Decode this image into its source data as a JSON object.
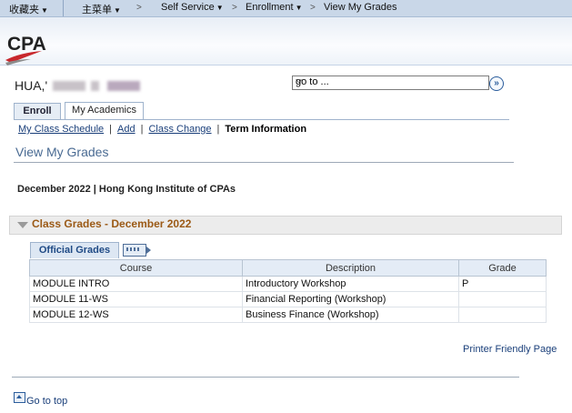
{
  "topnav": {
    "favorites": "收藏夹",
    "main_menu": "主菜单",
    "breadcrumbs": [
      "Self Service",
      "Enrollment",
      "View My Grades"
    ]
  },
  "banner": {
    "logo_text": "CPA"
  },
  "user": {
    "name_visible": "HUA,'"
  },
  "goto": {
    "value": "go to ..."
  },
  "tabs": [
    "Enroll",
    "My Academics"
  ],
  "subnav": {
    "items": [
      "My Class Schedule",
      "Add",
      "Class Change",
      "Term Information"
    ],
    "current": "Term Information"
  },
  "page": {
    "title": "View My Grades",
    "term": "December 2022 | Hong Kong Institute of CPAs"
  },
  "section": {
    "title": "Class Grades - December 2022"
  },
  "grid": {
    "tab_label": "Official Grades",
    "columns": [
      "Course",
      "Description",
      "Grade"
    ],
    "rows": [
      [
        "MODULE INTRO",
        "Introductory Workshop",
        "P"
      ],
      [
        "MODULE 11-WS",
        "Financial Reporting (Workshop)",
        ""
      ],
      [
        "MODULE 12-WS",
        "Business Finance (Workshop)",
        ""
      ]
    ]
  },
  "footer": {
    "printer_friendly": "Printer Friendly Page",
    "go_to_top": "Go to top"
  },
  "colors": {
    "nav_bg": "#c9d7e8",
    "section_title": "#9b5a16",
    "link": "#1a3f7a",
    "logo_red": "#c8282d"
  }
}
